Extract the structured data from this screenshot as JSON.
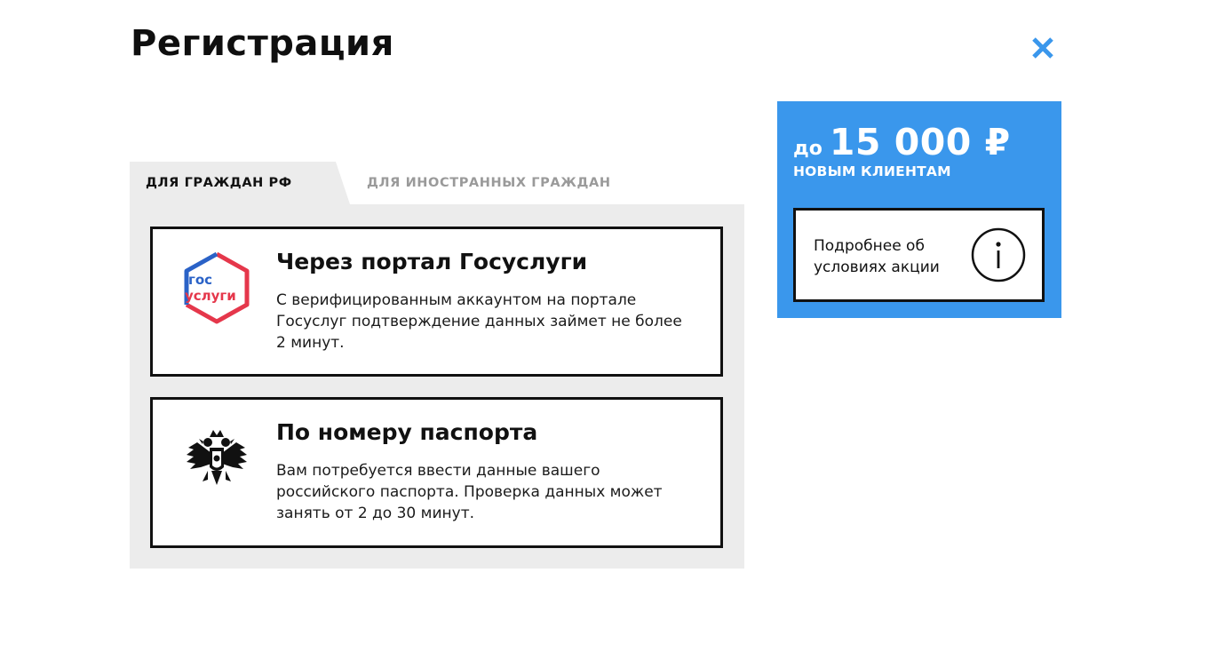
{
  "header": {
    "title": "Регистрация",
    "close_icon": "close-icon",
    "close_color": "#3a97ec"
  },
  "tabs": [
    {
      "label": "ДЛЯ ГРАЖДАН РФ",
      "active": true
    },
    {
      "label": "ДЛЯ ИНОСТРАННЫХ ГРАЖДАН",
      "active": false
    }
  ],
  "options": [
    {
      "title": "Через портал Госуслуги",
      "description": "С верифицированным аккаунтом на порталe Госуслуг подтверждение данных займет не более 2 минут.",
      "icon": "gosuslugi-logo",
      "logo_line1": "гос",
      "logo_line2": "услуги"
    },
    {
      "title": "По номеру паспорта",
      "description": "Вам потребуется ввести данные вашего российского паспорта. Проверка данных может занять от 2 до 30 минут.",
      "icon": "coat-of-arms-icon"
    }
  ],
  "promo": {
    "prefix": "до",
    "amount": "15 000 ₽",
    "subtitle": "НОВЫМ КЛИЕНТАМ",
    "info_text": "Подробнее об условиях акции",
    "info_icon": "info-icon",
    "background": "#3a97ec"
  }
}
